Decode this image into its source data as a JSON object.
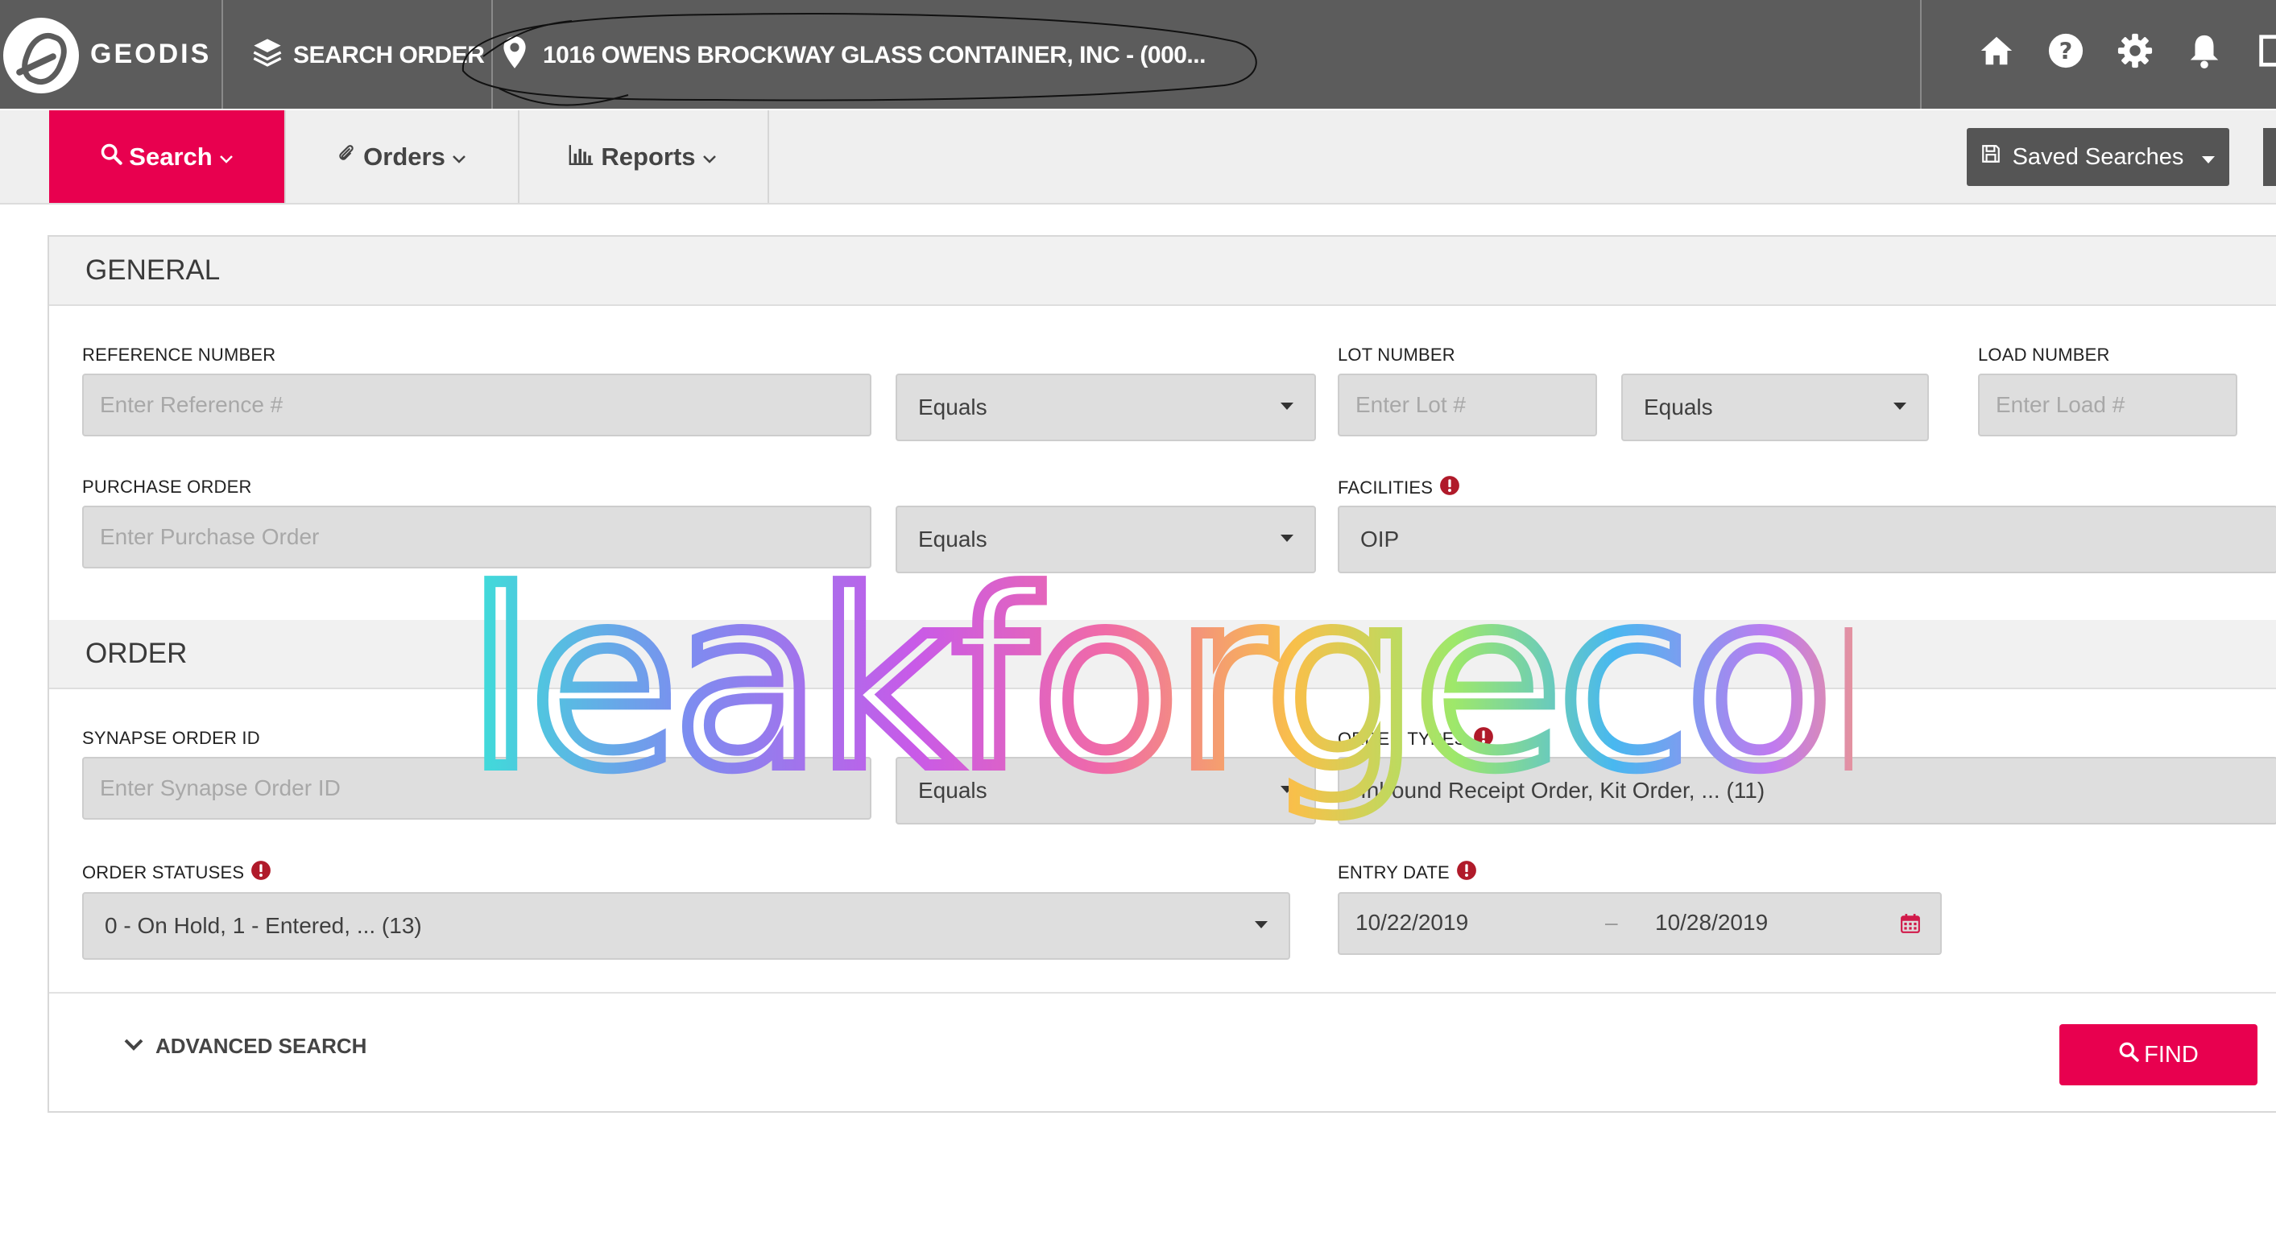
{
  "header": {
    "brand": "GEODIS",
    "search_order_label": "SEARCH ORDER",
    "location_label": "1016 OWENS BROCKWAY GLASS CONTAINER, INC - (000...",
    "icons": [
      "home-icon",
      "help-icon",
      "gear-icon",
      "bell-icon",
      "logout-icon"
    ]
  },
  "nav": {
    "tabs": [
      {
        "label": "Search",
        "icon": "search-icon",
        "active": true
      },
      {
        "label": "Orders",
        "icon": "paperclip-icon",
        "active": false
      },
      {
        "label": "Reports",
        "icon": "bar-chart-icon",
        "active": false
      }
    ],
    "saved_searches_label": "Saved Searches"
  },
  "general": {
    "title": "GENERAL",
    "reference_number": {
      "label": "REFERENCE NUMBER",
      "placeholder": "Enter Reference #",
      "operator": "Equals"
    },
    "lot_number": {
      "label": "LOT NUMBER",
      "placeholder": "Enter Lot #",
      "operator": "Equals"
    },
    "load_number": {
      "label": "LOAD NUMBER",
      "placeholder": "Enter Load #"
    },
    "purchase_order": {
      "label": "PURCHASE ORDER",
      "placeholder": "Enter Purchase Order",
      "operator": "Equals"
    },
    "facilities": {
      "label": "FACILITIES",
      "value": "OIP"
    }
  },
  "order": {
    "title": "ORDER",
    "synapse_order_id": {
      "label": "SYNAPSE ORDER ID",
      "placeholder": "Enter Synapse Order ID",
      "operator": "Equals"
    },
    "order_types": {
      "label": "ORDER TYPES",
      "value": "Inbound Receipt Order,  Kit Order, ... (11)"
    },
    "order_statuses": {
      "label": "ORDER STATUSES",
      "value": "0 - On Hold,  1 - Entered, ... (13)"
    },
    "entry_date": {
      "label": "ENTRY DATE",
      "from": "10/22/2019",
      "separator": "–",
      "to": "10/28/2019"
    }
  },
  "footer": {
    "advanced_search_label": "ADVANCED SEARCH",
    "find_label": "FIND"
  },
  "watermark": {
    "text": "leakforgecom"
  },
  "colors": {
    "accent": "#e8004f",
    "topbar": "#5c5c5c",
    "required": "#b01a2a"
  }
}
